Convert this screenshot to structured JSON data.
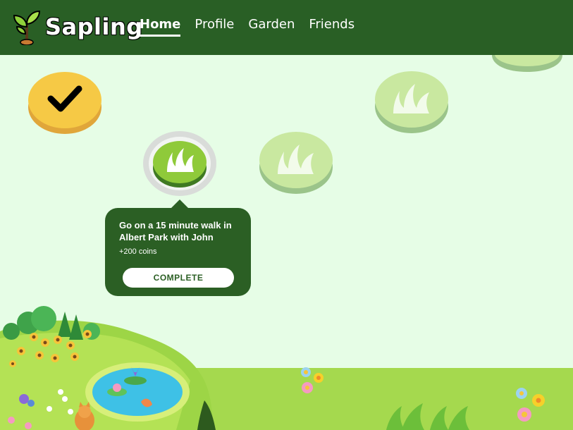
{
  "header": {
    "brand": "Sapling",
    "nav": [
      {
        "label": "Home",
        "active": true
      },
      {
        "label": "Profile",
        "active": false
      },
      {
        "label": "Garden",
        "active": false
      },
      {
        "label": "Friends",
        "active": false
      }
    ]
  },
  "path": {
    "nodes": [
      {
        "state": "completed",
        "icon": "checkmark-icon"
      },
      {
        "state": "current",
        "icon": "grass-icon"
      },
      {
        "state": "locked",
        "icon": "grass-icon"
      },
      {
        "state": "locked",
        "icon": "grass-icon"
      },
      {
        "state": "locked",
        "icon": "grass-icon"
      }
    ]
  },
  "tooltip": {
    "title": "Go on a 15 minute walk in Albert Park with John",
    "reward": "+200 coins",
    "button_label": "COMPLETE"
  },
  "colors": {
    "header_bg": "#295f25",
    "page_bg": "#e6fde6",
    "completed_node": "#f6c945",
    "current_node": "#8fca3a",
    "locked_node": "#c9e8a0",
    "ground": "#a5d94e"
  }
}
